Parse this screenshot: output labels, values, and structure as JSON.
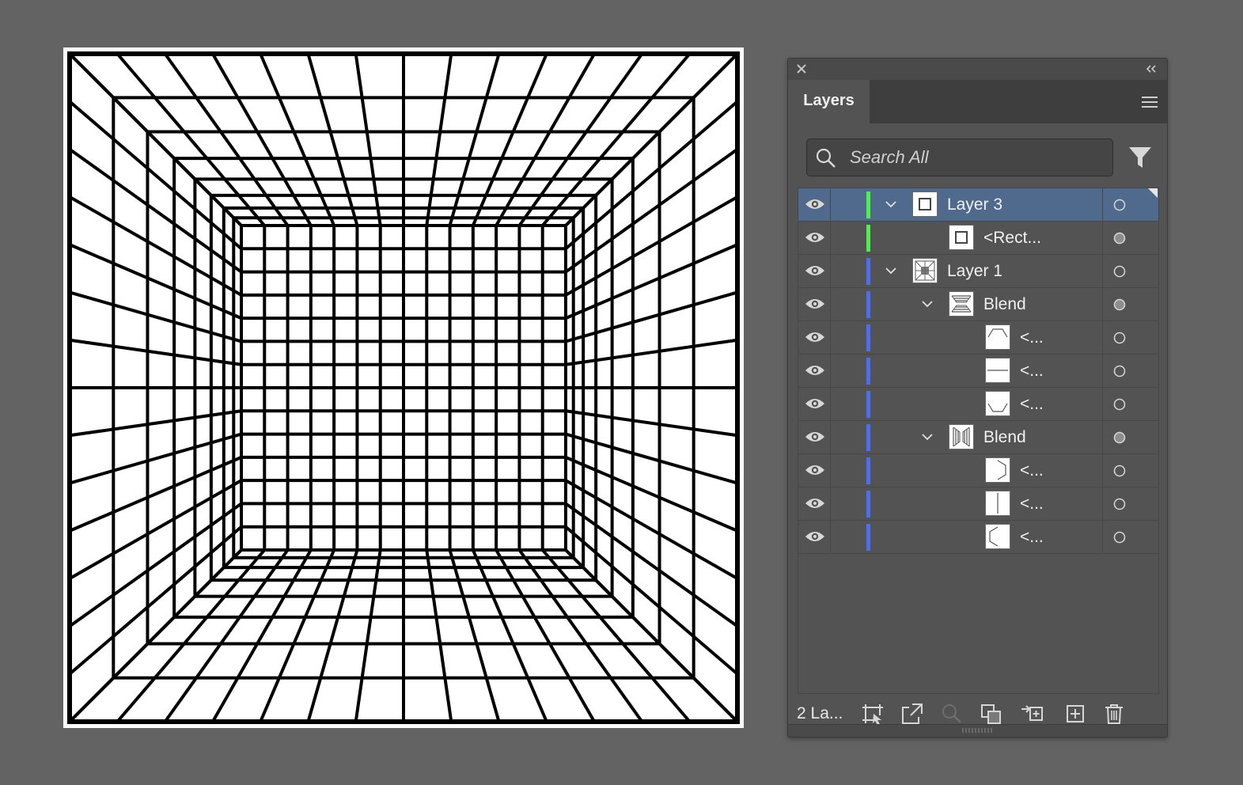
{
  "layers_panel": {
    "tab_label": "Layers",
    "search": {
      "placeholder": "Search All",
      "value": ""
    },
    "rows": [
      {
        "name": "Layer 3",
        "color": "#4ef04e",
        "selected": true,
        "thumb": "square-frame",
        "target": "hollow",
        "expanded": true
      },
      {
        "name": "<Rect...",
        "color": "#4ef04e",
        "selected": false,
        "thumb": "square-frame",
        "target": "filled"
      },
      {
        "name": "Layer 1",
        "color": "#4a6ff0",
        "selected": false,
        "thumb": "grid-room",
        "target": "hollow",
        "expanded": true
      },
      {
        "name": "Blend",
        "color": "#4a6ff0",
        "selected": false,
        "thumb": "blend-horizontal",
        "target": "filled",
        "expanded": true
      },
      {
        "name": "<...",
        "color": "#4a6ff0",
        "selected": false,
        "thumb": "top-trapezoid",
        "target": "hollow"
      },
      {
        "name": "<...",
        "color": "#4a6ff0",
        "selected": false,
        "thumb": "horizontal-line",
        "target": "hollow"
      },
      {
        "name": "<...",
        "color": "#4a6ff0",
        "selected": false,
        "thumb": "bottom-trapezoid",
        "target": "hollow"
      },
      {
        "name": "Blend",
        "color": "#4a6ff0",
        "selected": false,
        "thumb": "blend-vertical",
        "target": "filled",
        "expanded": true
      },
      {
        "name": "<...",
        "color": "#4a6ff0",
        "selected": false,
        "thumb": "right-trapezoid",
        "target": "hollow"
      },
      {
        "name": "<...",
        "color": "#4a6ff0",
        "selected": false,
        "thumb": "vertical-line",
        "target": "hollow"
      },
      {
        "name": "<...",
        "color": "#4a6ff0",
        "selected": false,
        "thumb": "left-trapezoid",
        "target": "hollow"
      }
    ],
    "footer": {
      "layer_count_label": "2 La..."
    }
  }
}
